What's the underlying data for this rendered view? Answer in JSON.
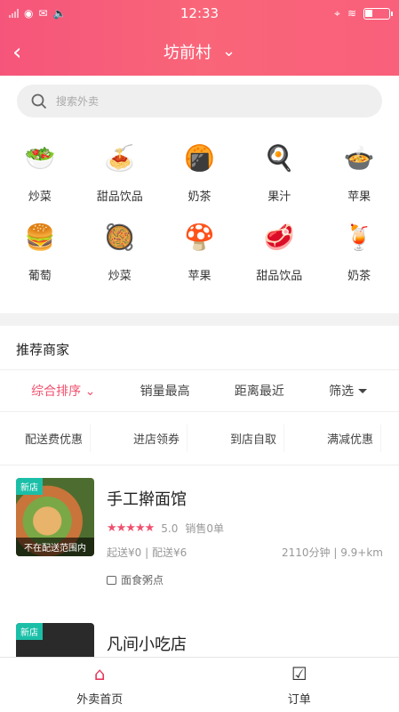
{
  "status": {
    "time": "12:33"
  },
  "header": {
    "title": "坊前村"
  },
  "search": {
    "placeholder": "搜索外卖"
  },
  "categories": [
    {
      "label": "炒菜",
      "icon": "fried-dish-icon",
      "glyph": "🥗"
    },
    {
      "label": "甜品饮品",
      "icon": "dessert-icon",
      "glyph": "🍝"
    },
    {
      "label": "奶茶",
      "icon": "milktea-icon",
      "glyph": "🍘"
    },
    {
      "label": "果汁",
      "icon": "juice-icon",
      "glyph": "🍳"
    },
    {
      "label": "苹果",
      "icon": "apple-icon",
      "glyph": "🍲"
    },
    {
      "label": "葡萄",
      "icon": "grape-icon",
      "glyph": "🍔"
    },
    {
      "label": "炒菜",
      "icon": "fried-dish-icon",
      "glyph": "🥘"
    },
    {
      "label": "苹果",
      "icon": "apple-icon",
      "glyph": "🍄"
    },
    {
      "label": "甜品饮品",
      "icon": "dessert-icon",
      "glyph": "🥩"
    },
    {
      "label": "奶茶",
      "icon": "milktea-icon",
      "glyph": "🍹"
    }
  ],
  "section": {
    "title": "推荐商家"
  },
  "sort": {
    "comprehensive": "综合排序",
    "sales": "销量最高",
    "distance": "距离最近",
    "filter": "筛选"
  },
  "filters": [
    "配送费优惠",
    "进店领券",
    "到店自取",
    "满减优惠"
  ],
  "shops": [
    {
      "badge": "新店",
      "name": "手工擀面馆",
      "rating": "5.0",
      "sales": "销售0单",
      "delivery": "起送¥0 | 配送¥6",
      "eta": "2110分钟 | 9.9+km",
      "tag": "面食粥点",
      "note": "不在配送范围内"
    },
    {
      "badge": "新店",
      "name": "凡间小吃店"
    }
  ],
  "tabbar": {
    "home": "外卖首页",
    "orders": "订单"
  }
}
